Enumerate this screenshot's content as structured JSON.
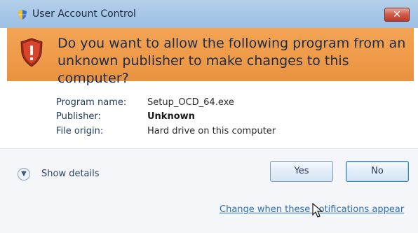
{
  "window": {
    "title": "User Account Control",
    "close_glyph": "✕"
  },
  "banner": {
    "question": "Do you want to allow the following program from an unknown publisher to make changes to this computer?"
  },
  "details": {
    "program_name_label": "Program name:",
    "program_name_value": "Setup_OCD_64.exe",
    "publisher_label": "Publisher:",
    "publisher_value": "Unknown",
    "file_origin_label": "File origin:",
    "file_origin_value": "Hard drive on this computer"
  },
  "footer": {
    "show_details_label": "Show details",
    "yes_label": "Yes",
    "no_label": "No",
    "change_link": "Change when these notifications appear"
  },
  "icons": {
    "title": "uac-shield-icon",
    "banner": "warning-shield-icon",
    "expander": "chevron-down-icon",
    "cursor": "mouse-cursor-icon"
  },
  "colors": {
    "banner": "#ee9a48",
    "titlebar": "#a4c5e6",
    "close_button": "#cf5a47",
    "link": "#2d6fb5"
  }
}
